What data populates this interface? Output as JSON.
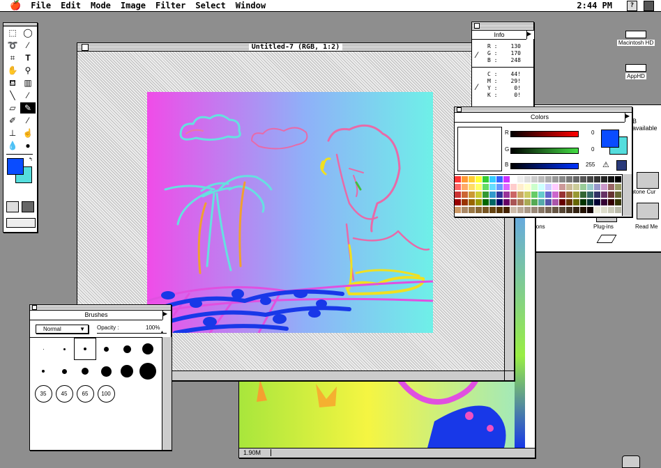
{
  "menubar": {
    "apple": "🍎",
    "items": [
      "File",
      "Edit",
      "Mode",
      "Image",
      "Filter",
      "Select",
      "Window"
    ],
    "clock": "2:44 PM",
    "help_icon": "?"
  },
  "document": {
    "title": "Untitled-7 (RGB, 1:2)",
    "status": "1.90M"
  },
  "info": {
    "title": "Info",
    "rgb": [
      {
        "k": "R :",
        "v": "130"
      },
      {
        "k": "G :",
        "v": "170"
      },
      {
        "k": "B :",
        "v": "248"
      }
    ],
    "cmyk": [
      {
        "k": "C :",
        "v": "44!"
      },
      {
        "k": "M :",
        "v": "29!"
      },
      {
        "k": "Y :",
        "v": "0!"
      },
      {
        "k": "K :",
        "v": "0!"
      }
    ]
  },
  "colors": {
    "title": "Colors",
    "r_label": "R",
    "g_label": "G",
    "b_label": "B",
    "r": "0",
    "g": "0",
    "b": "255",
    "fg": "#0a4cff",
    "bg": "#55dddd"
  },
  "brushes": {
    "title": "Brushes",
    "mode": "Normal",
    "opacity_label": "Opacity :",
    "opacity": "100%",
    "sizes": [
      "35",
      "45",
      "65",
      "100"
    ]
  },
  "finder": {
    "available": "B available",
    "items": [
      "totone Cur",
      "sions",
      "Plug-ins",
      "Read Me"
    ]
  },
  "desktop": {
    "icons": [
      "Macintosh HD",
      "AppHD"
    ]
  }
}
